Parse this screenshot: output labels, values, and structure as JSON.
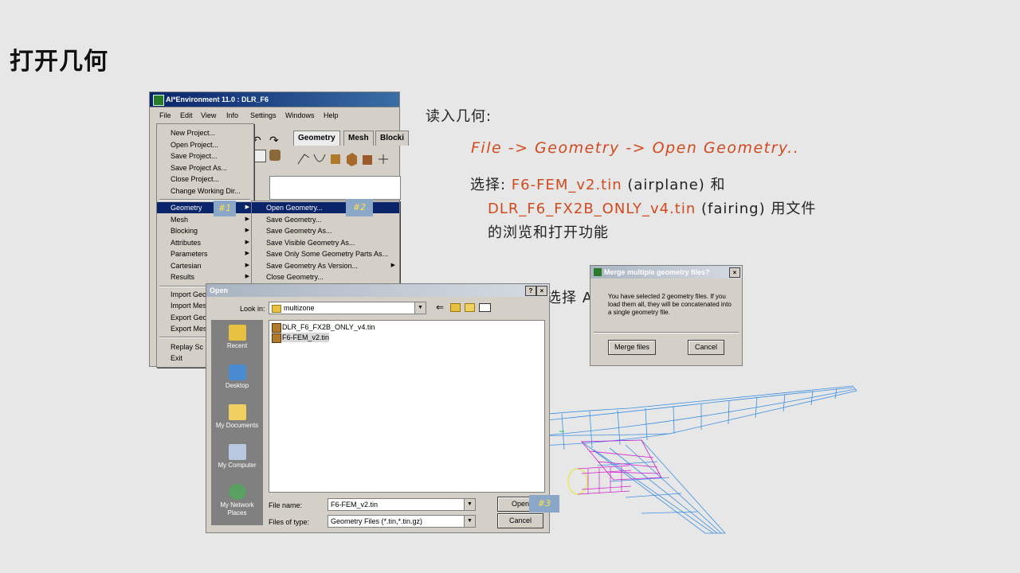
{
  "slide": {
    "title": "打开几何",
    "intro": "读入几何:",
    "path": "File -> Geometry -> Open Geometry..",
    "select_prefix": "选择: ",
    "file1": "F6-FEM_v2.tin",
    "file1_note": " (airplane) 和",
    "file2": "DLR_F6_FX2B_ONLY_v4.tin",
    "file2_note": " (fairing) 用文件",
    "line3": "的浏览和打开功能",
    "select2": "选择 A"
  },
  "ai_window": {
    "title": "AI*Environment 11.0 : DLR_F6",
    "menubar": [
      "File",
      "Edit",
      "View",
      "Info",
      "Settings",
      "Windows",
      "Help"
    ],
    "tabs": [
      "Geometry",
      "Mesh",
      "Blocki"
    ]
  },
  "file_menu": {
    "items": [
      "New Project...",
      "Open Project...",
      "Save Project...",
      "Save Project As...",
      "Close Project...",
      "Change Working Dir..."
    ],
    "sub_items": [
      "Geometry",
      "Mesh",
      "Blocking",
      "Attributes",
      "Parameters",
      "Cartesian",
      "Results"
    ],
    "import_items": [
      "Import Geo",
      "Import Mes",
      "Export Geo",
      "Export Mes"
    ],
    "replay_items": [
      "Replay Sc",
      "Exit"
    ]
  },
  "geometry_menu": {
    "items": [
      "Open Geometry...",
      "Save Geometry...",
      "Save Geometry As...",
      "Save Visible Geometry As...",
      "Save Only Some Geometry Parts As...",
      "Save Geometry As Version...",
      "Close Geometry..."
    ]
  },
  "markers": {
    "m1": "#1",
    "m2": "#2",
    "m3": "#3"
  },
  "open_dialog": {
    "title": "Open",
    "help": "?",
    "close": "×",
    "look_in_label": "Look in:",
    "look_in_value": "multizone",
    "places": [
      "Recent",
      "Desktop",
      "My Documents",
      "My Computer",
      "My Network Places"
    ],
    "files": [
      "DLR_F6_FX2B_ONLY_v4.tin",
      "F6-FEM_v2.tin"
    ],
    "file_name_label": "File name:",
    "file_name_value": "F6-FEM_v2.tin",
    "file_type_label": "Files of type:",
    "file_type_value": "Geometry Files (*.tin,*.tin.gz)",
    "open_btn": "Open",
    "cancel_btn": "Cancel"
  },
  "merge_dialog": {
    "title": "Merge multiple geometry files?",
    "close": "×",
    "message": "You have selected 2 geometry files.  If you load them all, they will be concatenated into a single geometry file.",
    "merge_btn": "Merge files",
    "cancel_btn": "Cancel"
  },
  "colors": {
    "accent_red": "#d24a1e",
    "menu_highlight": "#0a246a",
    "marker_bg": "#8ba7c7",
    "marker_text": "#ffe24a",
    "mesh_blue": "#3a8ee6",
    "mesh_magenta": "#d020d0",
    "mesh_yellow": "#e8e820"
  }
}
